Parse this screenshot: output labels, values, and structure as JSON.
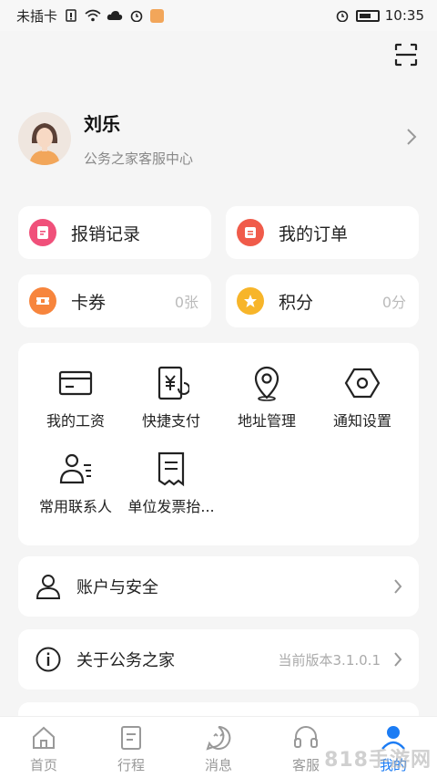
{
  "status_bar": {
    "carrier": "未插卡",
    "time": "10:35",
    "icons": [
      "sim-alert-icon",
      "wifi-icon",
      "cloud-icon",
      "alarm-icon",
      "app-notification-icon",
      "alarm-icon",
      "battery-icon"
    ]
  },
  "profile": {
    "name": "刘乐",
    "subtitle": "公务之家客服中心"
  },
  "quick_actions": [
    {
      "label": "报销记录",
      "icon": "reimbursement-icon",
      "color": "#f0507a"
    },
    {
      "label": "我的订单",
      "icon": "order-icon",
      "color": "#f05b4a"
    },
    {
      "label": "卡券",
      "value": "0张",
      "icon": "coupon-icon",
      "color": "#f7853d"
    },
    {
      "label": "积分",
      "value": "0分",
      "icon": "points-star-icon",
      "color": "#f7b52a"
    }
  ],
  "services": [
    {
      "label": "我的工资",
      "icon": "salary-card-icon"
    },
    {
      "label": "快捷支付",
      "icon": "quick-pay-icon"
    },
    {
      "label": "地址管理",
      "icon": "location-pin-icon"
    },
    {
      "label": "通知设置",
      "icon": "settings-hexagon-icon"
    },
    {
      "label": "常用联系人",
      "icon": "contacts-icon"
    },
    {
      "label": "单位发票抬...",
      "icon": "invoice-icon"
    }
  ],
  "menu": {
    "account": {
      "label": "账户与安全",
      "icon": "user-icon"
    },
    "about": {
      "label": "关于公务之家",
      "value": "当前版本3.1.0.1",
      "icon": "info-icon"
    }
  },
  "tabbar": [
    {
      "label": "首页",
      "icon": "home-icon",
      "active": false
    },
    {
      "label": "行程",
      "icon": "itinerary-icon",
      "active": false
    },
    {
      "label": "消息",
      "icon": "message-icon",
      "active": false
    },
    {
      "label": "客服",
      "icon": "headset-icon",
      "active": false
    },
    {
      "label": "我的",
      "icon": "profile-icon",
      "active": true
    }
  ],
  "watermark": "818手游网",
  "colors": {
    "accent": "#1c7cf4",
    "background": "#f5f5f5"
  }
}
